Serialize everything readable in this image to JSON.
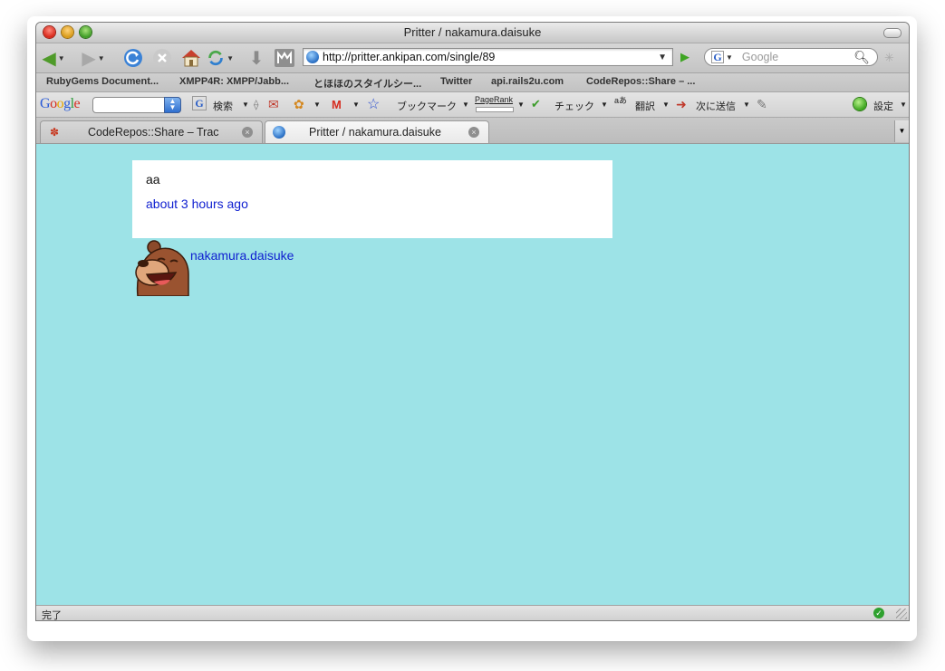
{
  "window": {
    "title": "Pritter / nakamura.daisuke"
  },
  "navbar": {
    "url": "http://pritter.ankipan.com/single/89",
    "search_placeholder": "Google"
  },
  "bookmarks": [
    "RubyGems Document...",
    "XMPP4R: XMPP/Jabb...",
    "とほほのスタイルシー...",
    "Twitter",
    "api.rails2u.com",
    "CodeRepos::Share – ..."
  ],
  "google_toolbar": {
    "search_label": "検索",
    "bookmark_label": "ブックマーク",
    "pagerank_label": "PageRank",
    "check_label": "チェック",
    "translate_label": "翻訳",
    "send_label": "次に送信",
    "settings_label": "設定"
  },
  "tabs": [
    {
      "label": "CodeRepos::Share – Trac",
      "active": false
    },
    {
      "label": "Pritter / nakamura.daisuke",
      "active": true
    }
  ],
  "post": {
    "text": "aa",
    "time": "about 3 hours ago",
    "username": "nakamura.daisuke"
  },
  "status": {
    "text": "完了"
  },
  "colors": {
    "content_background": "#9de3e7",
    "link": "#1020d0"
  }
}
